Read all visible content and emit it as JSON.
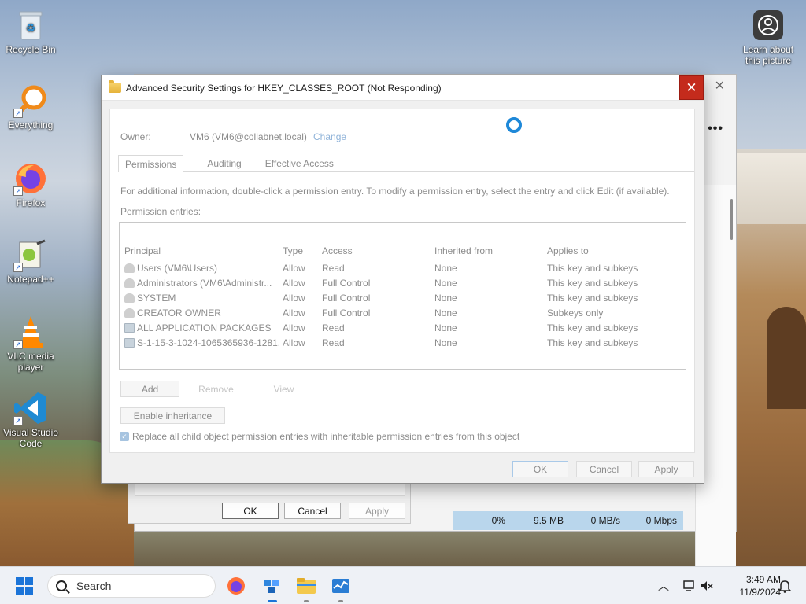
{
  "desktop": {
    "icons": [
      {
        "label": "Recycle Bin"
      },
      {
        "label": "Everything"
      },
      {
        "label": "Firefox"
      },
      {
        "label": "Notepad++"
      },
      {
        "label": "VLC media player"
      },
      {
        "label": "Visual Studio Code"
      }
    ],
    "learn_about": "Learn about this picture"
  },
  "background_window": {
    "stats": {
      "cpu": "0%",
      "memory": "9.5 MB",
      "disk": "0 MB/s",
      "network": "0 Mbps"
    }
  },
  "properties_window": {
    "ok": "OK",
    "cancel": "Cancel",
    "apply": "Apply"
  },
  "dialog": {
    "title": "Advanced Security Settings for HKEY_CLASSES_ROOT (Not Responding)",
    "owner_label": "Owner:",
    "owner_value": "VM6 (VM6@collabnet.local)",
    "change_link": "Change",
    "tabs": [
      {
        "label": "Permissions"
      },
      {
        "label": "Auditing"
      },
      {
        "label": "Effective Access"
      }
    ],
    "info_text": "For additional information, double-click a permission entry. To modify a permission entry, select the entry and click Edit (if available).",
    "entries_label": "Permission entries:",
    "columns": {
      "principal": "Principal",
      "type": "Type",
      "access": "Access",
      "inherited": "Inherited from",
      "applies": "Applies to"
    },
    "entries": [
      {
        "principal": "Users (VM6\\Users)",
        "type": "Allow",
        "access": "Read",
        "inherited": "None",
        "applies": "This key and subkeys"
      },
      {
        "principal": "Administrators (VM6\\Administr...",
        "type": "Allow",
        "access": "Full Control",
        "inherited": "None",
        "applies": "This key and subkeys"
      },
      {
        "principal": "SYSTEM",
        "type": "Allow",
        "access": "Full Control",
        "inherited": "None",
        "applies": "This key and subkeys"
      },
      {
        "principal": "CREATOR OWNER",
        "type": "Allow",
        "access": "Full Control",
        "inherited": "None",
        "applies": "Subkeys only"
      },
      {
        "principal": "ALL APPLICATION PACKAGES",
        "type": "Allow",
        "access": "Read",
        "inherited": "None",
        "applies": "This key and subkeys"
      },
      {
        "principal": "S-1-15-3-1024-1065365936-1281...",
        "type": "Allow",
        "access": "Read",
        "inherited": "None",
        "applies": "This key and subkeys"
      }
    ],
    "add": "Add",
    "remove": "Remove",
    "view": "View",
    "enable_inheritance": "Enable inheritance",
    "replace_child": "Replace all child object permission entries with inheritable permission entries from this object",
    "ok": "OK",
    "cancel": "Cancel",
    "apply": "Apply"
  },
  "taskbar": {
    "search_placeholder": "Search",
    "time": "3:49 AM",
    "date": "11/9/2024"
  }
}
